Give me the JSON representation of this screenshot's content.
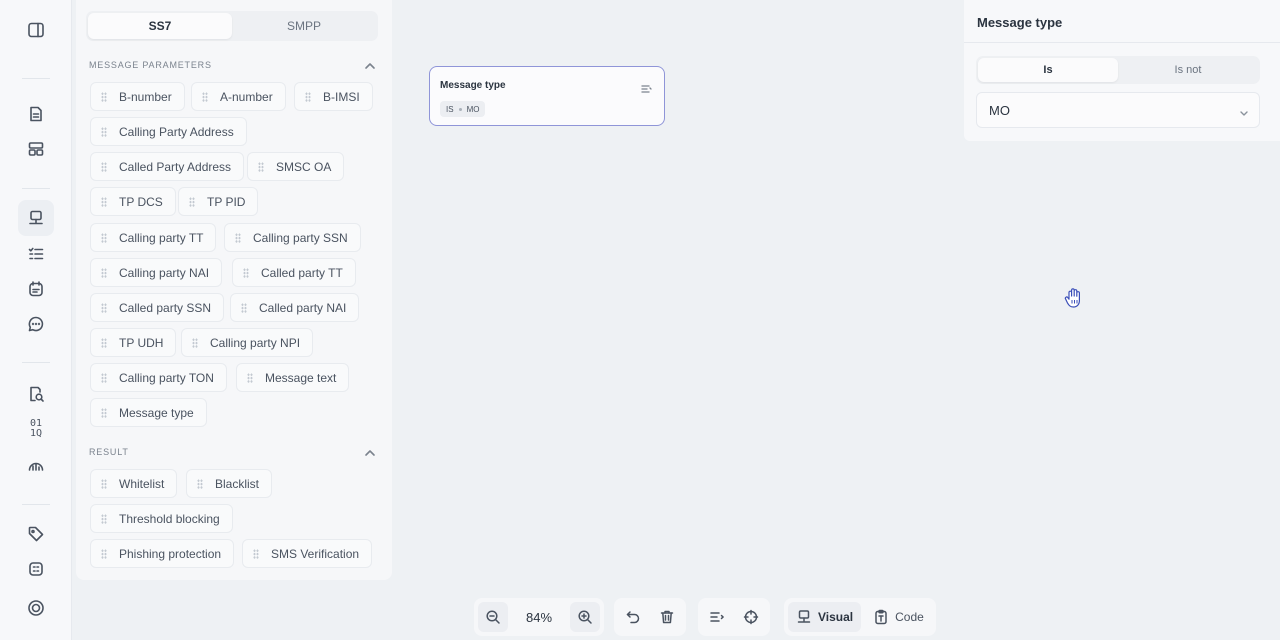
{
  "panel": {
    "tabs": [
      {
        "label": "SS7",
        "selected": true
      },
      {
        "label": "SMPP",
        "selected": false
      }
    ],
    "message_parameters_title": "MESSAGE PARAMETERS",
    "message_parameters": [
      "B-number",
      "A-number",
      "B-IMSI",
      "Calling Party Address",
      "Called Party Address",
      "SMSC OA",
      "TP DCS",
      "TP PID",
      "Calling party TT",
      "Calling party SSN",
      "Calling party NAI",
      "Called party TT",
      "Called party SSN",
      "Called party NAI",
      "TP UDH",
      "Calling party NPI",
      "Calling party TON",
      "Message text",
      "Message type"
    ],
    "result_title": "RESULT",
    "result_items": [
      "Whitelist",
      "Blacklist",
      "Threshold blocking",
      "Phishing protection",
      "SMS Verification"
    ]
  },
  "node": {
    "title": "Message type",
    "operator": "IS",
    "value": "MO"
  },
  "properties": {
    "title": "Message type",
    "options": [
      {
        "label": "Is",
        "selected": true
      },
      {
        "label": "Is not",
        "selected": false
      }
    ],
    "selected_value": "MO"
  },
  "toolbar": {
    "zoom": "84%",
    "visual_label": "Visual",
    "code_label": "Code"
  },
  "rail": {
    "binary_glyph_top": "01",
    "binary_glyph_bottom": "1Q"
  }
}
